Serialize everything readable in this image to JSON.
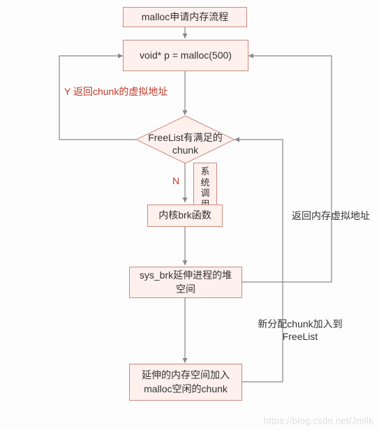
{
  "title": "malloc申请内存流程",
  "nodes": {
    "start": "void* p = malloc(500)",
    "decision": "FreeList有满足的chunk",
    "brk": "内核brk函数",
    "sysbrk": "sys_brk延伸进程的堆空间",
    "extend": "延伸的内存空间加入malloc空闲的chunk"
  },
  "labels": {
    "yes": "Y 返回chunk的虚拟地址",
    "no": "N",
    "syscall": "系统调用",
    "return_virt": "返回内存虚拟地址",
    "add_chunk": "新分配chunk加入到 FreeList"
  },
  "watermark": "https://blog.csdn.net/Jmilk"
}
